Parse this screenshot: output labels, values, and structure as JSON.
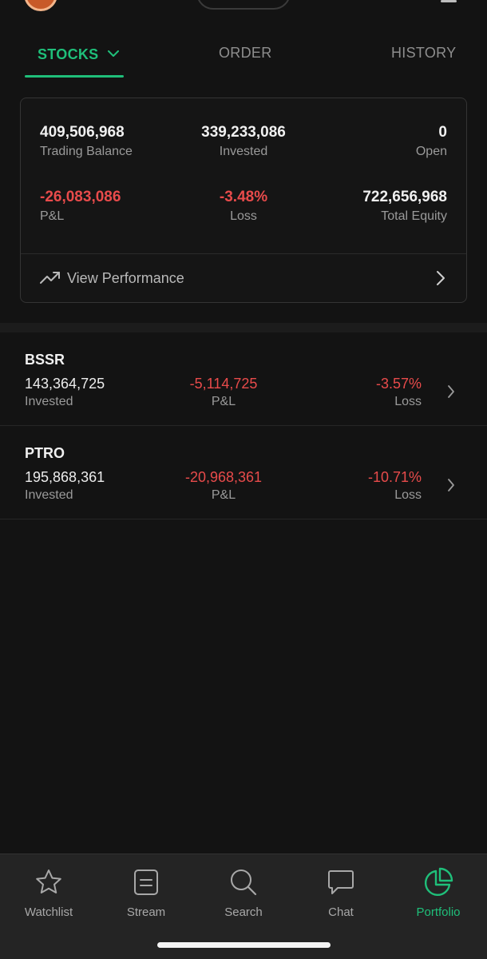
{
  "tabs": {
    "stocks": "STOCKS",
    "order": "ORDER",
    "history": "HISTORY"
  },
  "summary": {
    "trading_balance": {
      "value": "409,506,968",
      "label": "Trading Balance"
    },
    "invested": {
      "value": "339,233,086",
      "label": "Invested"
    },
    "open": {
      "value": "0",
      "label": "Open"
    },
    "pnl": {
      "value": "-26,083,086",
      "label": "P&L"
    },
    "loss": {
      "value": "-3.48%",
      "label": "Loss"
    },
    "total_equity": {
      "value": "722,656,968",
      "label": "Total Equity"
    },
    "view_performance": "View Performance"
  },
  "holdings": [
    {
      "ticker": "BSSR",
      "invested": "143,364,725",
      "invested_label": "Invested",
      "pnl": "-5,114,725",
      "pnl_label": "P&L",
      "pct": "-3.57%",
      "pct_label": "Loss"
    },
    {
      "ticker": "PTRO",
      "invested": "195,868,361",
      "invested_label": "Invested",
      "pnl": "-20,968,361",
      "pnl_label": "P&L",
      "pct": "-10.71%",
      "pct_label": "Loss"
    }
  ],
  "bottom_nav": {
    "watchlist": "Watchlist",
    "stream": "Stream",
    "search": "Search",
    "chat": "Chat",
    "portfolio": "Portfolio"
  },
  "colors": {
    "accent": "#1fbf7a",
    "negative": "#e84b4b",
    "background": "#131313"
  },
  "icons": {
    "watchlist": "star-icon",
    "stream": "stream-icon",
    "search": "search-icon",
    "chat": "chat-icon",
    "portfolio": "pie-chart-icon"
  }
}
